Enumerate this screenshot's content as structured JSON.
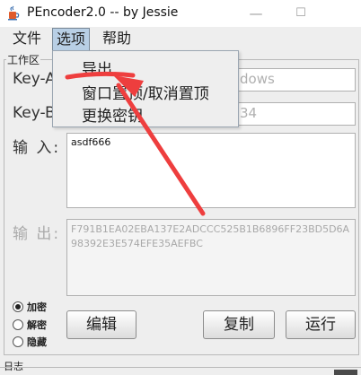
{
  "window": {
    "title": "PEncoder2.0 -- by Jessie",
    "minimize": "—",
    "maximize": "☐",
    "icon": "java-cup-icon"
  },
  "menubar": {
    "items": [
      "文件",
      "选项",
      "帮助"
    ],
    "active": "选项"
  },
  "dropdown": {
    "items": [
      "导出",
      "窗口置顶/取消置顶",
      "更换密钥"
    ]
  },
  "workspace": {
    "legend": "工作区",
    "key_a": {
      "label_visible": "Key-A",
      "value_visible": "dows"
    },
    "key_b": {
      "label_visible": "Key-B",
      "value_visible": "34"
    },
    "input_label": "输 入:",
    "input_text": "asdf666",
    "output_label": "输 出:",
    "output_text": "F791B1EA02EBA137E2ADCCC525B1B6896FF23BD5D6A98392E3E574EFE35AEFBC"
  },
  "modes": [
    {
      "label": "加密",
      "checked": true
    },
    {
      "label": "解密",
      "checked": false
    },
    {
      "label": "隐藏",
      "checked": false
    }
  ],
  "buttons": {
    "edit": "编辑",
    "copy": "复制",
    "run": "运行"
  },
  "log": {
    "legend": "日志"
  },
  "colors": {
    "menu_highlight": "#b8cfe5",
    "annotation_arrow": "#ee3e3e"
  }
}
